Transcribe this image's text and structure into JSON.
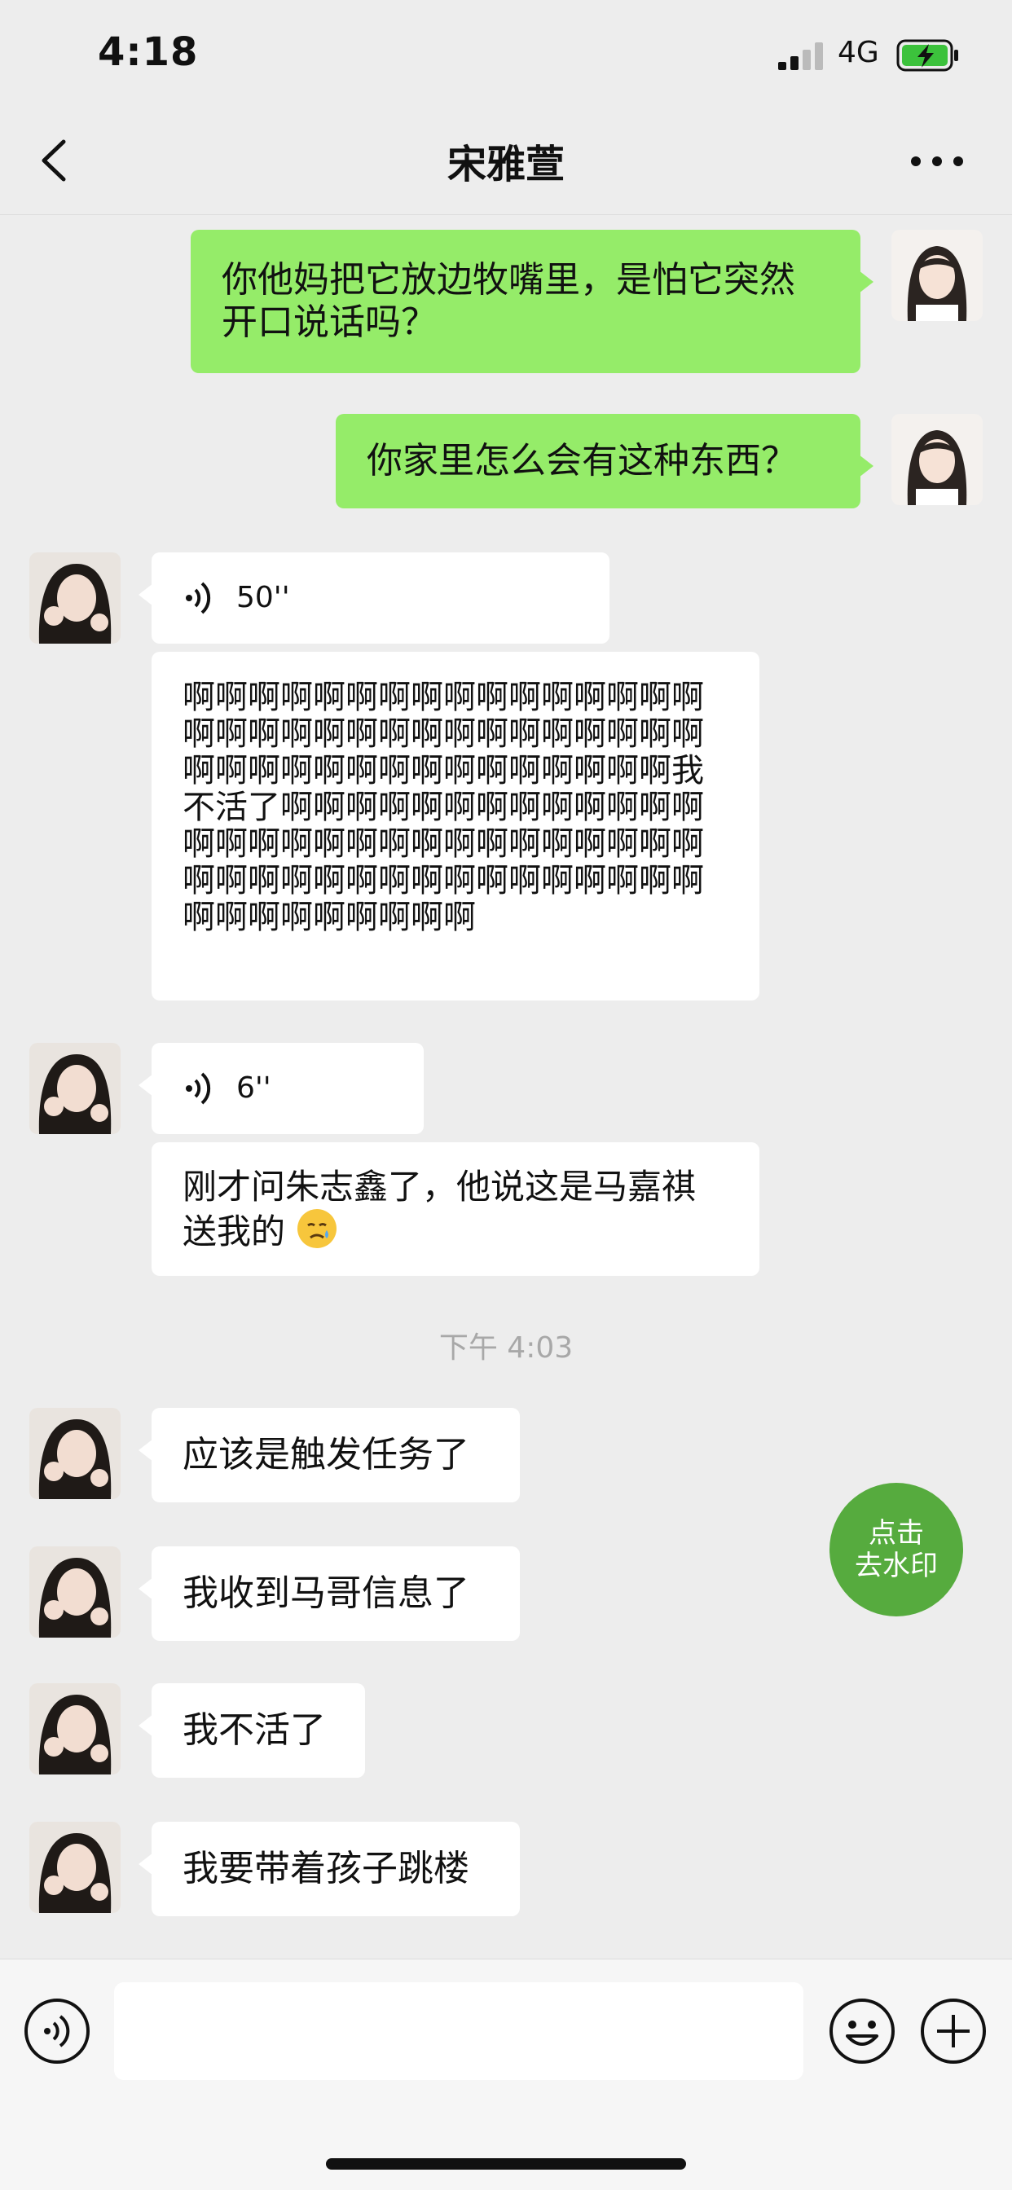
{
  "status_bar": {
    "time": "4:18",
    "network": "4G"
  },
  "header": {
    "title": "宋雅萱"
  },
  "messages": [
    {
      "text": "你他妈把它放边牧嘴里，是怕它突然开口说话吗？"
    },
    {
      "text": "你家里怎么会有这种东西？"
    },
    {
      "duration": "50''"
    },
    {
      "text": "啊啊啊啊啊啊啊啊啊啊啊啊啊啊啊啊啊啊啊啊啊啊啊啊啊啊啊啊啊啊啊啊啊啊啊啊啊啊啊啊啊啊啊啊啊啊啊我不活了啊啊啊啊啊啊啊啊啊啊啊啊啊啊啊啊啊啊啊啊啊啊啊啊啊啊啊啊啊啊啊啊啊啊啊啊啊啊啊啊啊啊啊啊啊啊啊啊啊啊啊啊啊啊"
    },
    {
      "duration": "6''"
    },
    {
      "text": "刚才问朱志鑫了，他说这是马嘉祺送我的"
    },
    {
      "text": "应该是触发任务了"
    },
    {
      "text": "我收到马哥信息了"
    },
    {
      "text": "我不活了"
    },
    {
      "text": "我要带着孩子跳楼"
    }
  ],
  "timestamp": "下午 4:03",
  "watermark_button": {
    "line1": "点击",
    "line2": "去水印"
  },
  "icons": {
    "signal": "signal-icon",
    "battery": "battery-charging-icon",
    "back": "chevron-left-icon",
    "more": "more-dots-icon",
    "voice_input": "voice-input-icon",
    "emoji": "emoji-icon",
    "plus": "plus-icon",
    "emoji_in_message": "crying-face-emoji"
  },
  "colors": {
    "outgoing_bubble": "#95ec69",
    "incoming_bubble": "#ffffff",
    "background": "#ededed",
    "watermark_button": "#56ab3e",
    "battery_charge": "#3cc23c"
  }
}
